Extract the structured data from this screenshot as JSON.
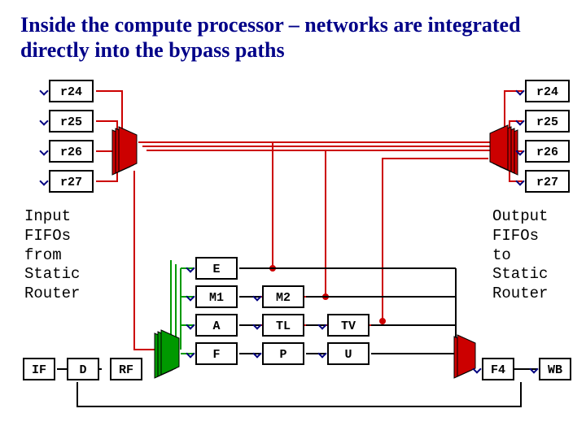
{
  "title": "Inside the compute processor – networks are integrated directly into the bypass paths",
  "regs_left": [
    "r24",
    "r25",
    "r26",
    "r27"
  ],
  "regs_right": [
    "r24",
    "r25",
    "r26",
    "r27"
  ],
  "note_left": "Input\nFIFOs\nfrom\nStatic\nRouter",
  "note_right": "Output\nFIFOs\nto\nStatic\nRouter",
  "pipeline": [
    "IF",
    "D",
    "RF"
  ],
  "fu_col1": [
    "E",
    "M1",
    "A",
    "F"
  ],
  "fu_col2": [
    "M2",
    "TL",
    "P"
  ],
  "fu_col3": [
    "TV",
    "U"
  ],
  "tail": [
    "F4",
    "WB"
  ],
  "colors": {
    "green": "#009900",
    "red": "#cc0000",
    "navy": "#000080",
    "black": "#000000"
  }
}
